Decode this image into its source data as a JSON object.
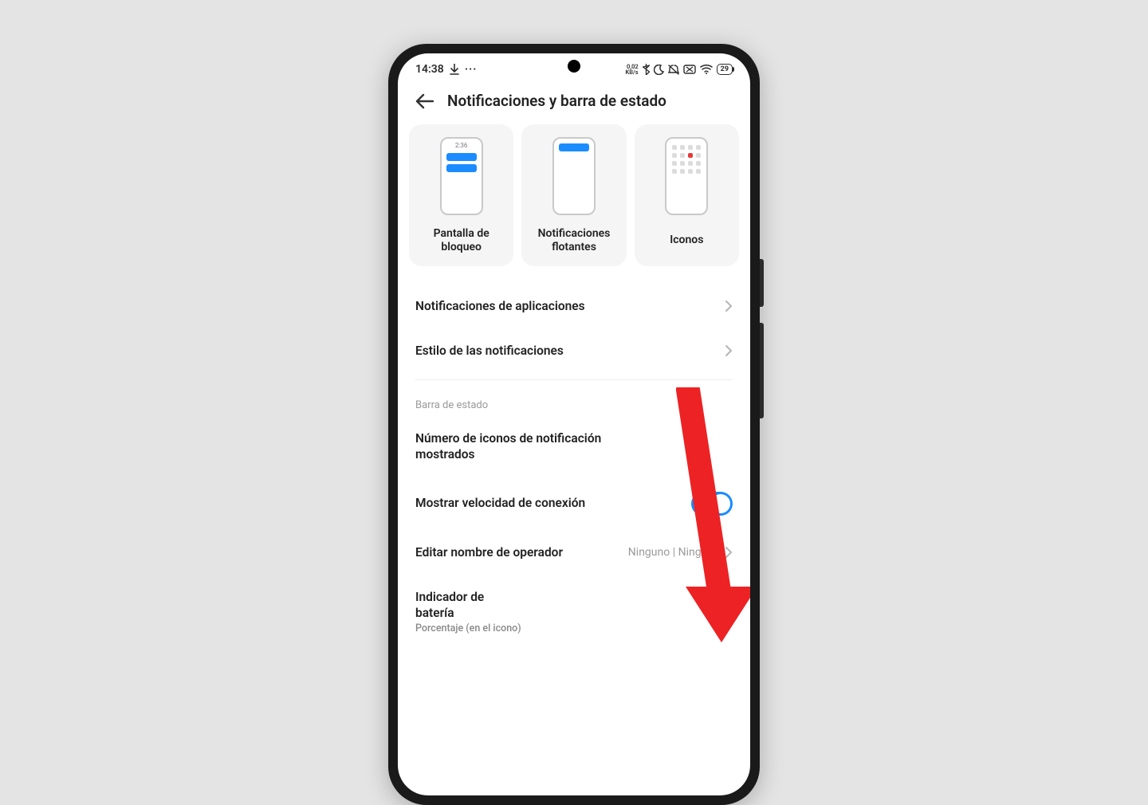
{
  "status_bar": {
    "time": "14:38",
    "download_icon": "download",
    "more_icon": "more",
    "speed_top": "0,02",
    "speed_bottom": "KB/s",
    "battery_percent": "29"
  },
  "header": {
    "title": "Notificaciones y barra de estado"
  },
  "cards": [
    {
      "id": "lock",
      "label": "Pantalla de bloqueo",
      "mini_clock": "2:36"
    },
    {
      "id": "float",
      "label": "Notificaciones flotantes"
    },
    {
      "id": "icons",
      "label": "Iconos"
    }
  ],
  "rows_top": [
    {
      "id": "apps",
      "label": "Notificaciones de aplicaciones"
    },
    {
      "id": "style",
      "label": "Estilo de las notificaciones"
    }
  ],
  "section_label": "Barra de estado",
  "rows_status": [
    {
      "id": "count",
      "label": "Número de iconos de notificación mostrados",
      "type": "label"
    },
    {
      "id": "speed",
      "label": "Mostrar velocidad de conexión",
      "type": "toggle",
      "toggle_on": true
    },
    {
      "id": "carrier",
      "label": "Editar nombre de operador",
      "type": "value-chevron",
      "value": "Ninguno | Ninguno"
    },
    {
      "id": "battery",
      "label": "Indicador de batería",
      "sublabel": "Porcentaje (en el icono)",
      "type": "updown"
    }
  ],
  "colors": {
    "accent": "#1a8cff",
    "annotation": "#ed2224"
  }
}
